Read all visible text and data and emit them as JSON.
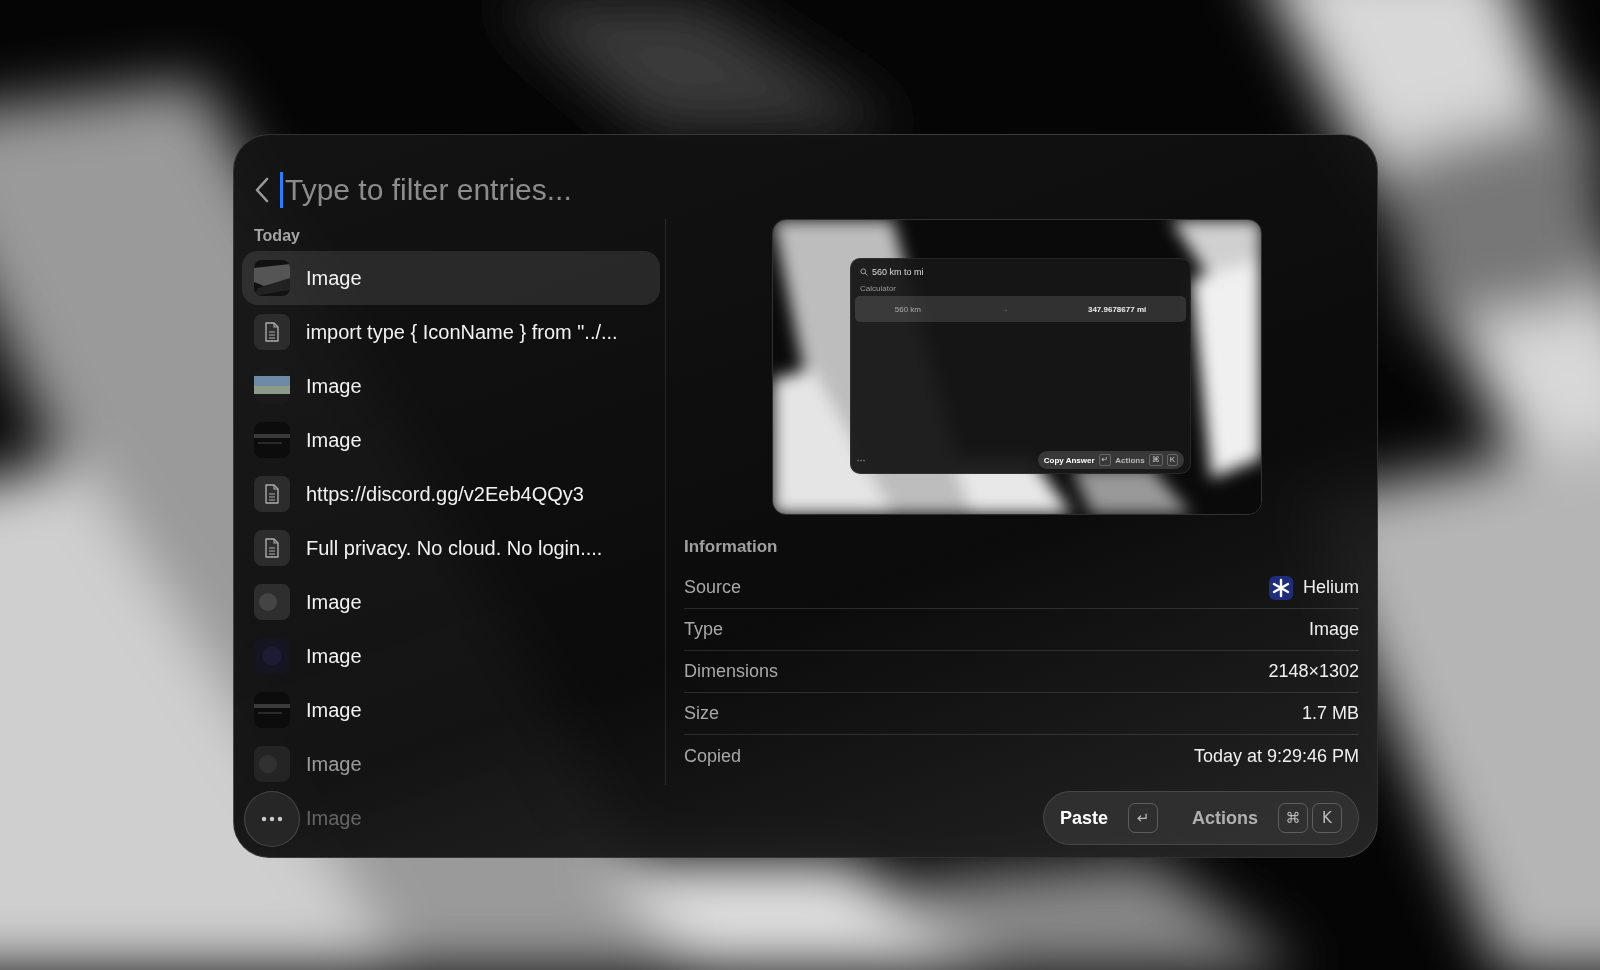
{
  "search": {
    "placeholder": "Type to filter entries..."
  },
  "section": "Today",
  "entries": [
    {
      "label": "Image",
      "selected": true
    },
    {
      "kind": "text",
      "label": "import type { IconName } from \"../...",
      "selected": false
    },
    {
      "label": "Image",
      "selected": false
    },
    {
      "label": "Image",
      "selected": false
    },
    {
      "kind": "text",
      "label": "https://discord.gg/v2Eeb4QQy3",
      "selected": false
    },
    {
      "kind": "text",
      "label": "Full privacy. No cloud. No login....",
      "selected": false
    },
    {
      "label": "Image",
      "selected": false
    },
    {
      "label": "Image",
      "selected": false
    },
    {
      "label": "Image",
      "selected": false
    },
    {
      "label": "Image",
      "selected": false
    },
    {
      "label": "Image"
    }
  ],
  "preview": {
    "query": "560 km to mi",
    "section": "Calculator",
    "from": "560 km",
    "arrow": "→",
    "result": "347.9678677 mi",
    "primary_action": "Copy Answer",
    "primary_keys": [
      "↵"
    ],
    "secondary_action": "Actions",
    "secondary_keys": [
      "⌘",
      "K"
    ]
  },
  "information": {
    "title": "Information",
    "rows": [
      {
        "kind": "app",
        "label": "Source",
        "value": "Helium"
      },
      {
        "kind": "plain",
        "label": "Type",
        "value": "Image"
      },
      {
        "kind": "plain",
        "label": "Dimensions",
        "value": "2148×1302"
      },
      {
        "kind": "plain",
        "label": "Size",
        "value": "1.7 MB"
      },
      {
        "kind": "plain",
        "label": "Copied",
        "value": "Today at 9:29:46 PM"
      }
    ]
  },
  "action_bar": {
    "primary": {
      "label": "Paste",
      "keys": [
        "↵"
      ]
    },
    "secondary": {
      "label": "Actions",
      "keys": [
        "⌘",
        "K"
      ]
    }
  }
}
